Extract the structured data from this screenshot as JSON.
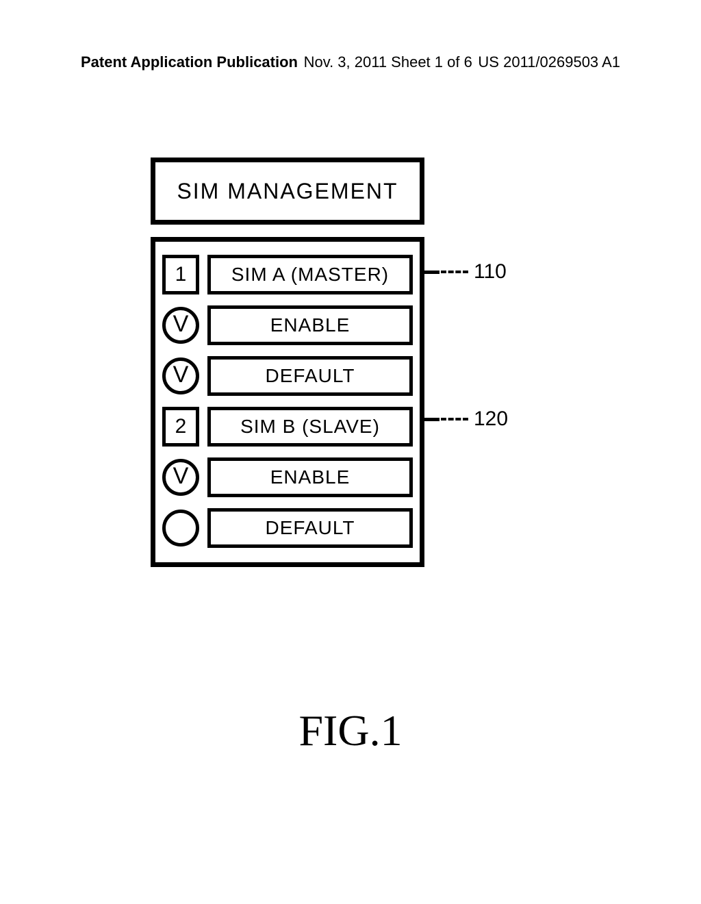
{
  "header": {
    "left": "Patent Application Publication",
    "mid": "Nov. 3, 2011  Sheet 1 of 6",
    "right": "US 2011/0269503 A1"
  },
  "title": "SIM MANAGEMENT",
  "rows": [
    {
      "indicator_type": "num",
      "indicator_text": "1",
      "label": "SIM A (MASTER)"
    },
    {
      "indicator_type": "check",
      "indicator_text": "V",
      "label": "ENABLE"
    },
    {
      "indicator_type": "check",
      "indicator_text": "V",
      "label": "DEFAULT"
    },
    {
      "indicator_type": "num",
      "indicator_text": "2",
      "label": "SIM B (SLAVE)"
    },
    {
      "indicator_type": "check",
      "indicator_text": "V",
      "label": "ENABLE"
    },
    {
      "indicator_type": "empty",
      "indicator_text": "",
      "label": "DEFAULT"
    }
  ],
  "callouts": {
    "c110": "110",
    "c120": "120"
  },
  "figure_label": "FIG.1"
}
